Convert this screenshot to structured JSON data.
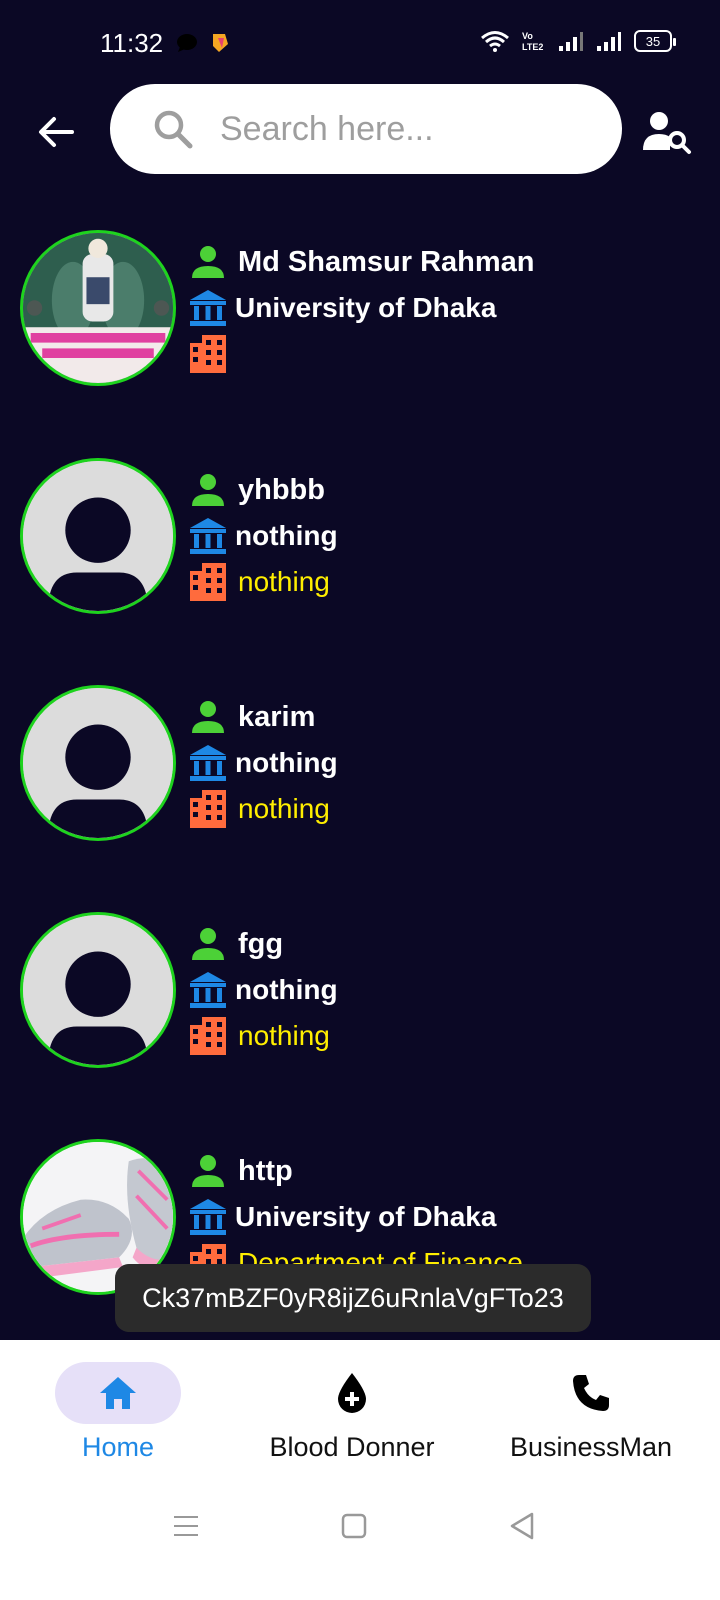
{
  "status": {
    "time": "11:32",
    "battery": "35"
  },
  "search": {
    "placeholder": "Search here..."
  },
  "colors": {
    "background": "#0b0825",
    "avatar_border": "#1ed31e",
    "person_icon": "#4cd137",
    "bank_icon": "#1e88e5",
    "dept_icon": "#ff6b3d",
    "dept_text": "#ffee00",
    "nav_active": "#1e88e5",
    "nav_pill": "#e6e0f8"
  },
  "users": [
    {
      "name": "Md Shamsur Rahman",
      "institution": "University of Dhaka",
      "department": "",
      "avatar": "photo-banner"
    },
    {
      "name": "yhbbb",
      "institution": "nothing",
      "department": "nothing",
      "avatar": "default-avatar"
    },
    {
      "name": "karim",
      "institution": "nothing",
      "department": "nothing",
      "avatar": "default-avatar"
    },
    {
      "name": "fgg",
      "institution": "nothing",
      "department": "nothing",
      "avatar": "default-avatar"
    },
    {
      "name": "http",
      "institution": "University of Dhaka",
      "department": "Department of Finance",
      "avatar": "photo-shoes"
    }
  ],
  "toast": {
    "text": "Ck37mBZF0yR8ijZ6uRnlaVgFTo23"
  },
  "nav": {
    "items": [
      {
        "label": "Home",
        "icon": "home-icon",
        "active": true
      },
      {
        "label": "Blood Donner",
        "icon": "blood-drop-icon",
        "active": false
      },
      {
        "label": "BusinessMan",
        "icon": "phone-icon",
        "active": false
      }
    ]
  }
}
